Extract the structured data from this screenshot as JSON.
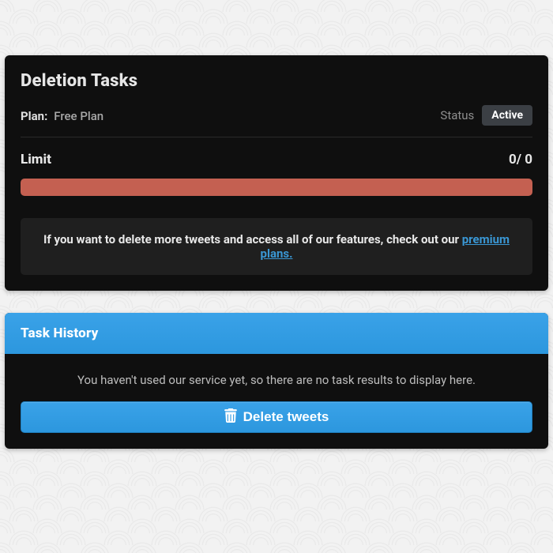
{
  "deletion_tasks": {
    "title": "Deletion Tasks",
    "plan_label": "Plan:",
    "plan_value": "Free Plan",
    "status_label": "Status",
    "status_badge": "Active",
    "limit_label": "Limit",
    "limit_value": "0/ 0",
    "progress_color": "#c46051",
    "notice_prefix": "If you want to delete more tweets and access all of our features, check out our ",
    "notice_link_text": "premium plans."
  },
  "task_history": {
    "title": "Task History",
    "empty_message": "You haven't used our service yet, so there are no task results to display here.",
    "button_label": "Delete tweets"
  },
  "colors": {
    "accent": "#2c97de",
    "card_bg": "#0f0f0f",
    "notice_bg": "#1f1f1f"
  }
}
